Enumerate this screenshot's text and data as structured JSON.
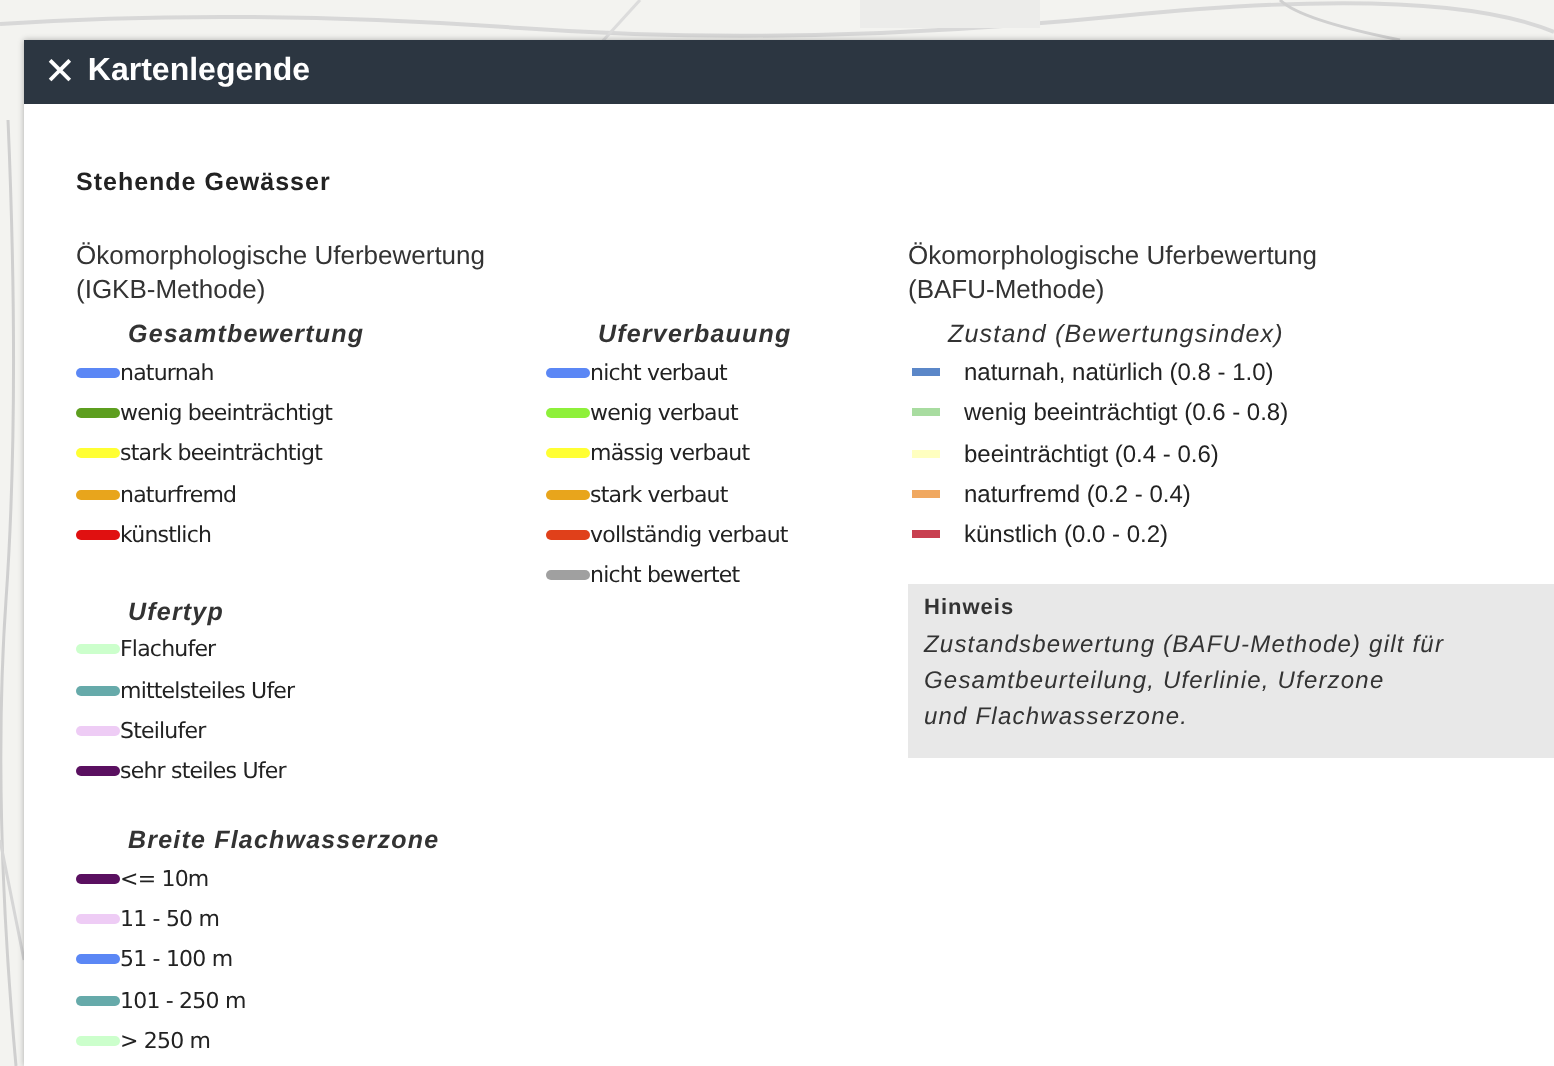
{
  "window": {
    "close_icon": "✕",
    "title": "Kartenlegende"
  },
  "section_title": "Stehende Gewässer",
  "legends": [
    {
      "kind": "igkb",
      "title": "Ökomorphologische Uferbewertung (IGKB-Methode)",
      "groups": [
        {
          "heading": "Gesamtbewertung",
          "items": [
            {
              "label": "naturnah",
              "color": "#5b87f5"
            },
            {
              "label": "wenig beeinträchtigt",
              "color": "#5d9e1f"
            },
            {
              "label": "stark beeinträchtigt",
              "color": "#ffff33"
            },
            {
              "label": "naturfremd",
              "color": "#e8a51c"
            },
            {
              "label": "künstlich",
              "color": "#e01010"
            }
          ]
        },
        {
          "heading": "Uferverbauung",
          "items": [
            {
              "label": "nicht verbaut",
              "color": "#5b87f5"
            },
            {
              "label": "wenig verbaut",
              "color": "#8ef03a"
            },
            {
              "label": "mässig verbaut",
              "color": "#ffff33"
            },
            {
              "label": "stark verbaut",
              "color": "#e8a51c"
            },
            {
              "label": "vollständig verbaut",
              "color": "#e0401a"
            },
            {
              "label": "nicht bewertet",
              "color": "#a0a0a0"
            }
          ]
        },
        {
          "heading": "Ufertyp",
          "items": [
            {
              "label": "Flachufer",
              "color": "#ccffcc"
            },
            {
              "label": "mittelsteiles Ufer",
              "color": "#66aaaa"
            },
            {
              "label": "Steilufer",
              "color": "#eeccf5"
            },
            {
              "label": "sehr steiles Ufer",
              "color": "#5a1060"
            }
          ]
        },
        {
          "heading": "Breite Flachwasserzone",
          "items": [
            {
              "label": "<= 10m",
              "color": "#5a1060"
            },
            {
              "label": "11 - 50 m",
              "color": "#eeccf5"
            },
            {
              "label": "51 - 100 m",
              "color": "#5b87f5"
            },
            {
              "label": "101 - 250 m",
              "color": "#66aaaa"
            },
            {
              "label": "> 250 m",
              "color": "#ccffcc"
            }
          ]
        }
      ]
    },
    {
      "kind": "bafu",
      "title": "Ökomorphologische Uferbewertung (BAFU-Methode)",
      "groups": [
        {
          "heading": "Zustand (Bewertungsindex)",
          "items": [
            {
              "label": "naturnah, natürlich (0.8 - 1.0)",
              "color": "#5b87c8"
            },
            {
              "label": "wenig beeinträchtigt (0.6 - 0.8)",
              "color": "#a8dca0"
            },
            {
              "label": "beeinträchtigt (0.4 - 0.6)",
              "color": "#ffffc0"
            },
            {
              "label": "naturfremd (0.2 - 0.4)",
              "color": "#f0a860"
            },
            {
              "label": "künstlich (0.0 - 0.2)",
              "color": "#c84050"
            }
          ]
        }
      ],
      "note": {
        "title": "Hinweis",
        "text": "Zustandsbewertung (BAFU-Methode) gilt für\nGesamtbeurteilung, Uferlinie, Uferzone\nund Flachwasserzone."
      }
    }
  ]
}
